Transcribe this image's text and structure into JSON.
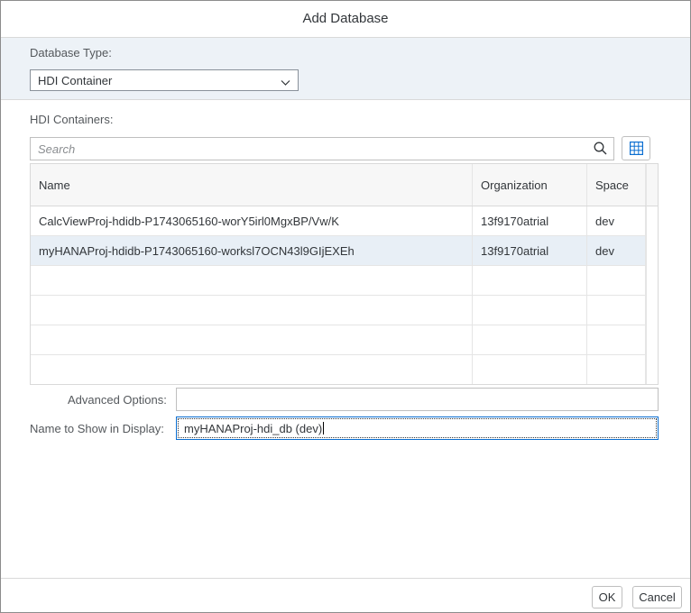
{
  "dialog": {
    "title": "Add Database"
  },
  "database_type": {
    "label": "Database Type:",
    "selected": "HDI Container"
  },
  "containers": {
    "label": "HDI Containers:",
    "search_placeholder": "Search",
    "columns": [
      "Name",
      "Organization",
      "Space"
    ],
    "rows": [
      {
        "name": "CalcViewProj-hdidb-P1743065160-worY5irl0MgxBP/Vw/K",
        "organization": "13f9170atrial",
        "space": "dev",
        "selected": false
      },
      {
        "name": "myHANAProj-hdidb-P1743065160-worksl7OCN43l9GIjEXEh",
        "organization": "13f9170atrial",
        "space": "dev",
        "selected": true
      }
    ],
    "empty_rows": 4
  },
  "advanced_options": {
    "label": "Advanced Options:",
    "value": ""
  },
  "display_name": {
    "label": "Name to Show in Display:",
    "value": "myHANAProj-hdi_db (dev)"
  },
  "buttons": {
    "ok": "OK",
    "cancel": "Cancel"
  },
  "icons": {
    "dropdown": "chevron-down-icon",
    "search": "search-icon",
    "grid": "table-settings-icon"
  },
  "colors": {
    "accent": "#0a6ed1",
    "section_bg": "#edf2f7",
    "selected_row": "#e8eff6"
  }
}
